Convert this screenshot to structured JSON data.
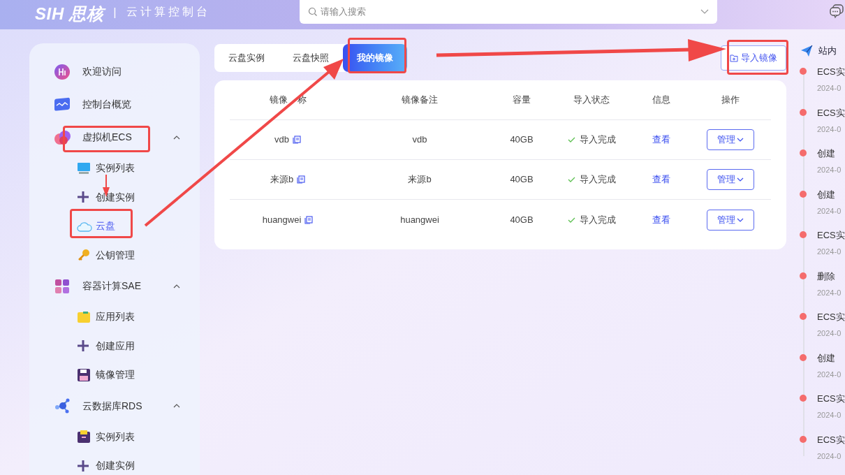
{
  "header": {
    "logo": "SIH 思核",
    "divider": "|",
    "title": "云计算控制台",
    "search": {
      "placeholder": "请输入搜索"
    }
  },
  "sidebar": {
    "items": [
      {
        "label": "欢迎访问",
        "selected": false
      },
      {
        "label": "控制台概览",
        "selected": false
      },
      {
        "label": "虚拟机ECS",
        "expanded": true,
        "selected": false,
        "children": [
          {
            "label": "实例列表",
            "selected": false
          },
          {
            "label": "创建实例",
            "selected": false
          },
          {
            "label": "云盘",
            "selected": true
          },
          {
            "label": "公钥管理",
            "selected": false
          }
        ]
      },
      {
        "label": "容器计算SAE",
        "expanded": true,
        "selected": false,
        "children": [
          {
            "label": "应用列表",
            "selected": false
          },
          {
            "label": "创建应用",
            "selected": false
          },
          {
            "label": "镜像管理",
            "selected": false
          }
        ]
      },
      {
        "label": "云数据库RDS",
        "expanded": true,
        "selected": false,
        "children": [
          {
            "label": "实例列表",
            "selected": false
          },
          {
            "label": "创建实例",
            "selected": false
          }
        ]
      }
    ]
  },
  "tabs": [
    {
      "label": "云盘实例",
      "selected": false
    },
    {
      "label": "云盘快照",
      "selected": false
    },
    {
      "label": "我的镜像",
      "selected": true
    }
  ],
  "import_button": "导入镜像",
  "table": {
    "columns": [
      [
        "镜像",
        "称"
      ],
      "镜像备注",
      "容量",
      "导入状态",
      "信息",
      "操作"
    ],
    "rows": [
      {
        "name": "vdb",
        "remark": "vdb",
        "capacity": "40GB",
        "status": "导入完成",
        "info": "查看",
        "action": "管理"
      },
      {
        "name": "来源b",
        "remark": "来源b",
        "capacity": "40GB",
        "status": "导入完成",
        "info": "查看",
        "action": "管理"
      },
      {
        "name": "huangwei",
        "remark": "huangwei",
        "capacity": "40GB",
        "status": "导入完成",
        "info": "查看",
        "action": "管理"
      }
    ]
  },
  "notifications": {
    "title": "站内",
    "items": [
      {
        "text": "ECS实",
        "date": "2024-0"
      },
      {
        "text": "ECS实",
        "date": "2024-0"
      },
      {
        "text": "创建",
        "date": "2024-0"
      },
      {
        "text": "创建",
        "date": "2024-0"
      },
      {
        "text": "ECS实",
        "date": "2024-0"
      },
      {
        "text": "删除",
        "date": "2024-0"
      },
      {
        "text": "ECS实",
        "date": "2024-0"
      },
      {
        "text": "创建",
        "date": "2024-0"
      },
      {
        "text": "ECS实",
        "date": "2024-0"
      },
      {
        "text": "ECS实",
        "date": "2024-0"
      }
    ]
  }
}
